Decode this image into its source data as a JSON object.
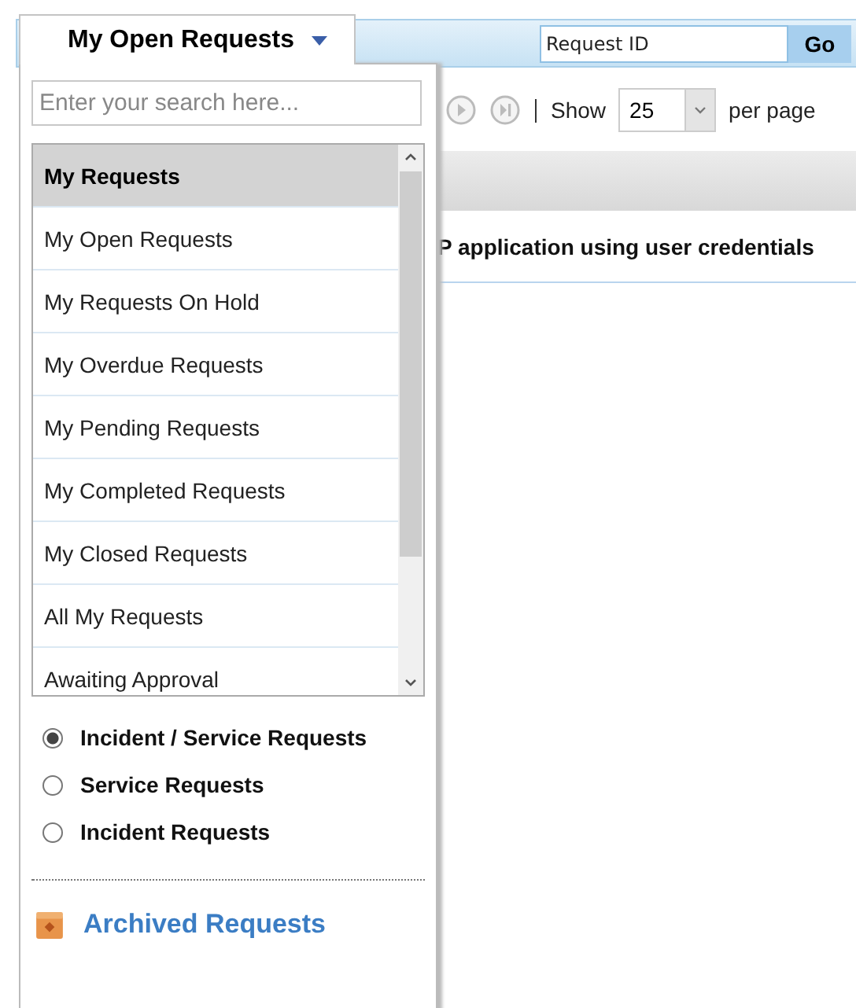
{
  "header_tab": {
    "label": "My Open Requests"
  },
  "request_id": {
    "placeholder": "Request ID"
  },
  "go_button": "Go",
  "pager": {
    "show_label": "Show",
    "per_page_value": "25",
    "per_page_label": "per page"
  },
  "row_text": "P application using user credentials",
  "dropdown": {
    "search": {
      "placeholder": "Enter your search here..."
    },
    "items": [
      {
        "label": "My Requests",
        "kind": "header"
      },
      {
        "label": "My Open Requests",
        "kind": "item"
      },
      {
        "label": "My Requests On Hold",
        "kind": "item"
      },
      {
        "label": "My Overdue Requests",
        "kind": "item"
      },
      {
        "label": "My Pending Requests",
        "kind": "item"
      },
      {
        "label": "My Completed Requests",
        "kind": "item"
      },
      {
        "label": "My Closed Requests",
        "kind": "item"
      },
      {
        "label": "All My Requests",
        "kind": "item"
      },
      {
        "label": "Awaiting Approval",
        "kind": "item"
      }
    ],
    "filters": [
      {
        "label": "Incident / Service Requests",
        "selected": true
      },
      {
        "label": "Service Requests",
        "selected": false
      },
      {
        "label": "Incident Requests",
        "selected": false
      }
    ],
    "archived_link": "Archived Requests"
  }
}
